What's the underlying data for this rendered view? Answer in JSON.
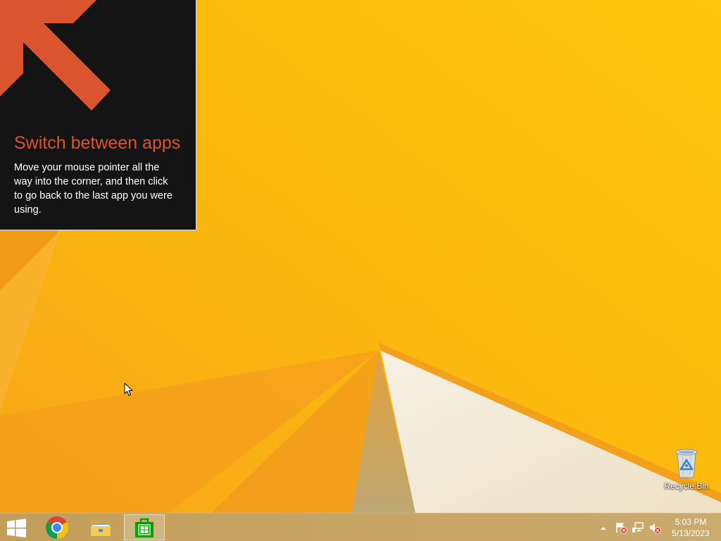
{
  "tip": {
    "title": "Switch between apps",
    "description": "Move your mouse pointer all the way into the corner, and then click to go back to the last app you were using.",
    "arrow_icon": "arrow-up-left-icon"
  },
  "desktop": {
    "recycle_bin": {
      "label": "Recycle Bin",
      "icon": "recycle-bin-icon"
    }
  },
  "taskbar": {
    "start_button": {
      "icon": "windows-logo-icon"
    },
    "apps": [
      {
        "icon": "chrome-icon",
        "active": false
      },
      {
        "icon": "file-explorer-icon",
        "active": false
      },
      {
        "icon": "store-icon",
        "active": true
      }
    ],
    "tray": {
      "icons": [
        "show-hidden-icons-arrow-icon",
        "action-center-flag-icon",
        "network-icon",
        "volume-muted-icon"
      ],
      "time": "5:03 PM",
      "date": "5/13/2023"
    }
  },
  "colors": {
    "tip_accent": "#d9542f",
    "tip_background": "#141414",
    "taskbar": "#c6a463",
    "wallpaper_yellow": "#fcc00c",
    "wallpaper_orange": "#f6a11b",
    "wallpaper_cream": "#f3e9d6",
    "store_green": "#00a300"
  }
}
